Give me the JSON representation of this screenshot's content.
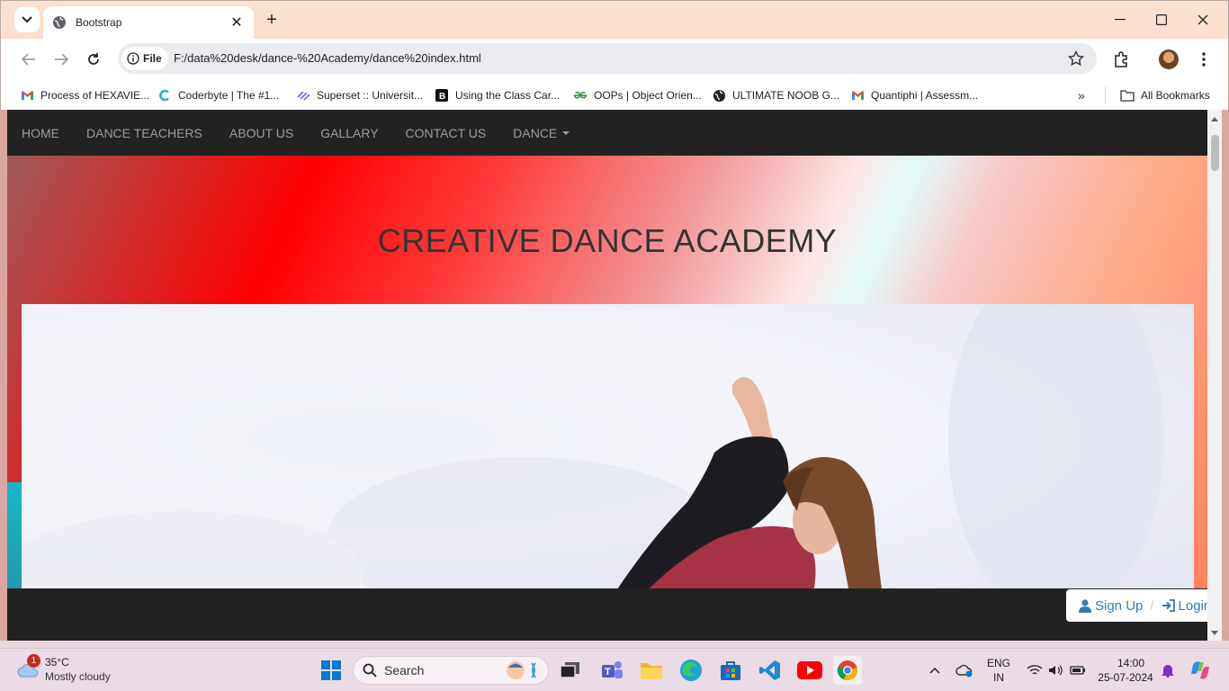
{
  "browser": {
    "tab_title": "Bootstrap",
    "url_chip": "File",
    "url": "F:/data%20desk/dance-%20Academy/dance%20index.html",
    "bookmarks": [
      {
        "label": "Process of HEXAVIE...",
        "icon": "gmail-icon"
      },
      {
        "label": "Coderbyte | The #1...",
        "icon": "coderbyte-icon"
      },
      {
        "label": "Superset :: Universit...",
        "icon": "superset-icon"
      },
      {
        "label": "Using the Class Car...",
        "icon": "bootstrap-icon"
      },
      {
        "label": "OOPs | Object Orien...",
        "icon": "geeksforgeeks-icon"
      },
      {
        "label": "ULTIMATE NOOB G...",
        "icon": "globe-icon"
      },
      {
        "label": "Quantiphi | Assessm...",
        "icon": "gmail-icon"
      }
    ],
    "all_bookmarks": "All Bookmarks",
    "more_bookmarks": "»"
  },
  "page": {
    "nav": [
      {
        "label": "HOME"
      },
      {
        "label": "DANCE TEACHERS"
      },
      {
        "label": "ABOUT US"
      },
      {
        "label": "GALLARY"
      },
      {
        "label": "CONTACT US"
      },
      {
        "label": "DANCE"
      }
    ],
    "hero_title": "CREATIVE DANCE ACADEMY",
    "signup": "Sign Up",
    "separator": "/",
    "login": "Login"
  },
  "taskbar": {
    "weather_temp": "35°C",
    "weather_desc": "Mostly cloudy",
    "weather_badge": "1",
    "search_label": "Search",
    "lang_line1": "ENG",
    "lang_line2": "IN",
    "time": "14:00",
    "date": "25-07-2024"
  },
  "colors": {
    "navbar": "#222222",
    "link": "#337ab7",
    "nav_text": "#9d9d9d"
  }
}
